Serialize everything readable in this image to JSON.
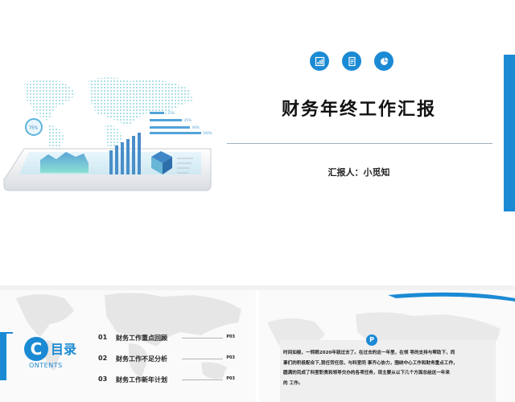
{
  "cover": {
    "title": "财务年终工作汇报",
    "reporter": "汇报人：小觅知",
    "icons": [
      "bar-chart-icon",
      "document-icon",
      "pie-chart-icon"
    ],
    "hero_percent": "75%",
    "hero_bar_labels": [
      "15%",
      "45%",
      "90%",
      "100%"
    ]
  },
  "contents": {
    "logo_letter": "C",
    "title": "目录",
    "subtitle": "ONTENTS",
    "items": [
      {
        "num": "01",
        "label": "财务工作重点回顾",
        "page": "P03"
      },
      {
        "num": "02",
        "label": "财务工作不足分析",
        "page": "P03"
      },
      {
        "num": "03",
        "label": "财务工作新年计划",
        "page": "P03"
      }
    ]
  },
  "intro": {
    "badge": "P",
    "lines": [
      "时间如梭，一转眼2020年就过去了。在过去的这一年里，在领 导的支持与帮助下，同",
      "事们的积极配合下,我任劳任怨，与科室同 事齐心协力，围绕中心工作和财务重点工作，",
      "圆满的完成了科室职责和领导交办的各项任务，现主要从以下几个方面总结这一年来",
      "的 工作。"
    ]
  },
  "colors": {
    "accent": "#1b8ad4",
    "divider": "#9fb0bd"
  }
}
